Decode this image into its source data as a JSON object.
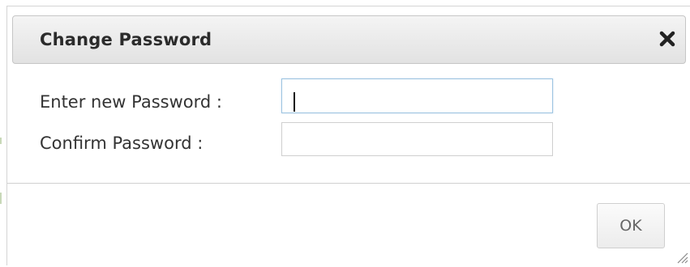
{
  "dialog": {
    "title": "Change Password",
    "close_icon": "close-icon"
  },
  "form": {
    "new_password": {
      "label": "Enter new Password :",
      "value": "",
      "focused": true
    },
    "confirm_password": {
      "label": "Confirm Password :",
      "value": ""
    }
  },
  "footer": {
    "ok_label": "OK",
    "resize_icon": "resize-grip-icon"
  },
  "colors": {
    "titlebar_gradient_top": "#f4f4f4",
    "titlebar_gradient_bottom": "#e2e2e2",
    "title_text": "#2b2b2b",
    "focus_border": "#9ec5e2"
  }
}
